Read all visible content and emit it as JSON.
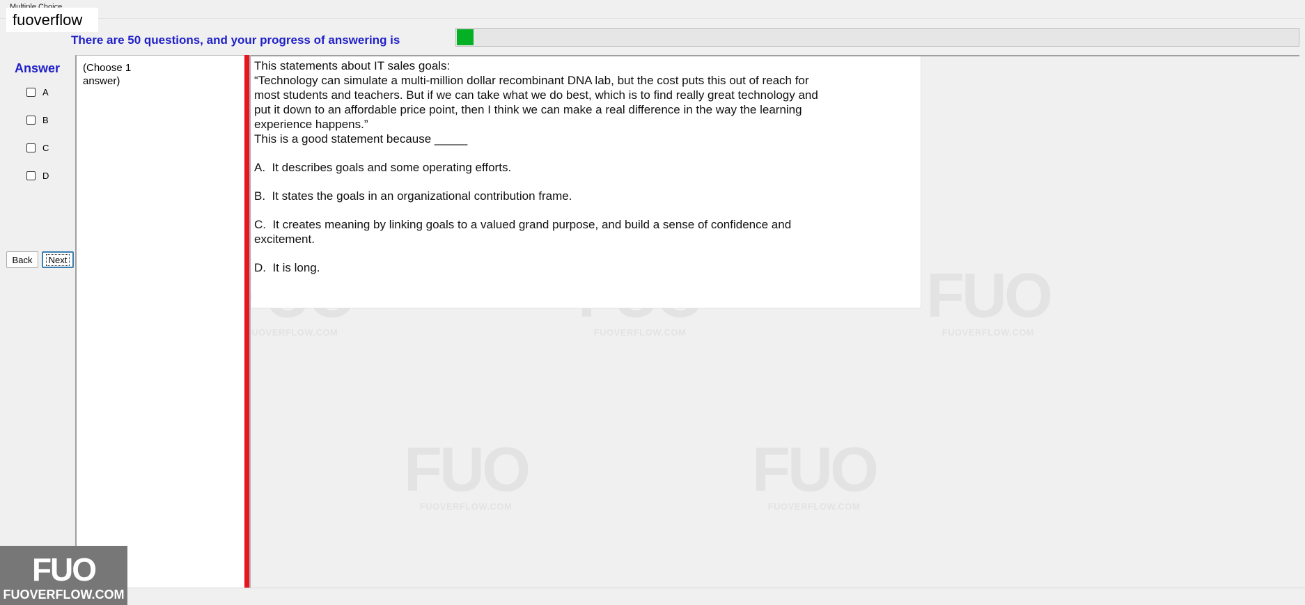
{
  "window": {
    "tab_peek": "Multiple Choice",
    "brand_label": "fuoverflow"
  },
  "progress": {
    "text": "There are 50 questions, and your progress of answering is",
    "fraction": 0.02,
    "color": "#06b025"
  },
  "answer_panel": {
    "heading": "Answer",
    "options": [
      {
        "label": "A",
        "checked": false
      },
      {
        "label": "B",
        "checked": false
      },
      {
        "label": "C",
        "checked": false
      },
      {
        "label": "D",
        "checked": false
      }
    ]
  },
  "nav": {
    "back_label": "Back",
    "next_label": "Next"
  },
  "choose_panel": {
    "text": "(Choose 1 answer)"
  },
  "question": {
    "lines": [
      "This statements about IT sales goals:",
      "“Technology can simulate a multi-million dollar recombinant DNA lab, but the cost puts this out of reach for",
      "most students and teachers. But if we can take what we do best, which is to find really great technology and",
      "put it down to an affordable price point, then I think we can make a real difference in the way the learning",
      "experience happens.”",
      "This is a good statement because _____"
    ],
    "options": [
      "A.  It describes goals and some operating efforts.",
      "B.  It states the goals in an organizational contribution frame.",
      "C.  It creates meaning by linking goals to a valued grand purpose, and build a sense of confidence and\nexcitement.",
      "D.  It is long."
    ]
  },
  "watermark": {
    "mark": "FUO",
    "site": "FUOVERFLOW.COM"
  },
  "logo": {
    "mark": "FUO",
    "site": "FUOVERFLOW.COM"
  },
  "colors": {
    "accent_blue": "#1f1fc8",
    "red_bar": "#e8141f",
    "progress_green": "#06b025"
  }
}
